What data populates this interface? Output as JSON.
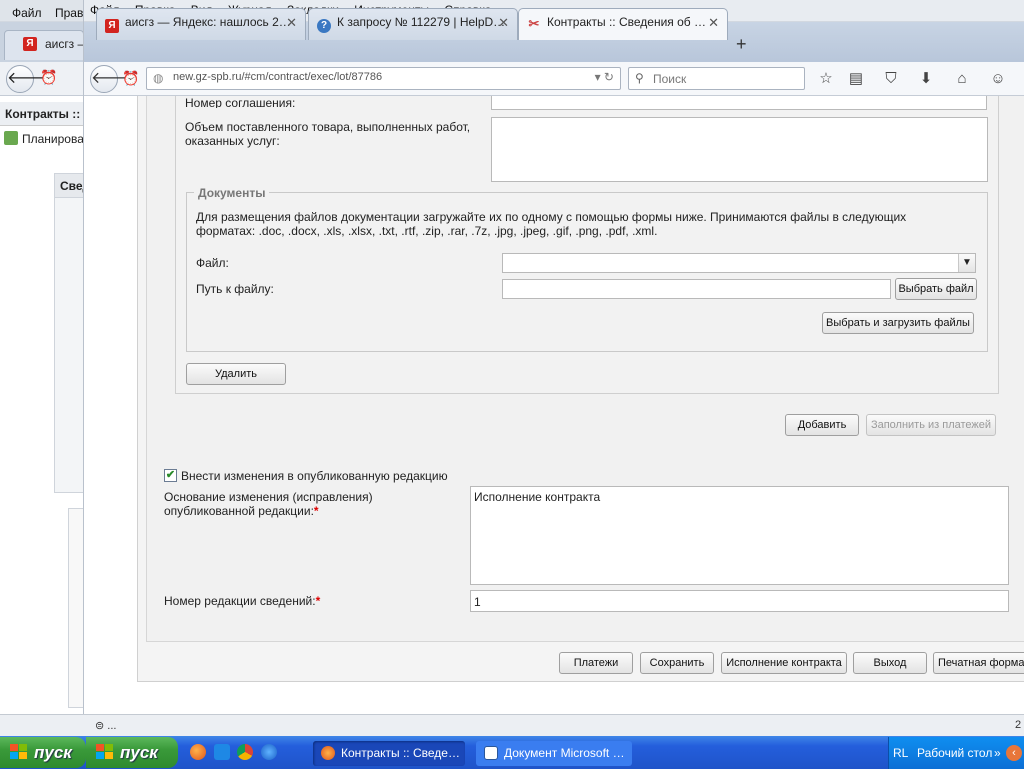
{
  "bg_window": {
    "menu": [
      "Файл",
      "Правка"
    ],
    "tab_title": "аисгз —",
    "page_header": "Контракты ::",
    "nav_item": "Планирован",
    "panel_title": "Свед",
    "status_text": "⊜ ..."
  },
  "menu": [
    "Файл",
    "Правка",
    "Вид",
    "Журнал",
    "Закладки",
    "Инструменты",
    "Справка"
  ],
  "tabs": [
    {
      "title": "аисгз — Яндекс: нашлось 2…",
      "icon": "Я",
      "color": "#d2241f"
    },
    {
      "title": "К запросу № 112279 | HelpD…",
      "icon": "?",
      "color": "#3a78c2"
    },
    {
      "title": "Контракты :: Сведения об …",
      "icon": "",
      "color": "#c44"
    }
  ],
  "url": "new.gz-spb.ru/#cm/contract/exec/lot/87786",
  "search_placeholder": "Поиск",
  "form": {
    "agreement_number_label": "Номер соглашения:",
    "volume_label": "Объем поставленного товара, выполненных работ, оказанных услуг:",
    "documents": {
      "legend": "Документы",
      "hint": "Для размещения файлов документации загружайте их по одному с помощью формы ниже. Принимаются файлы в следующих форматах: .doc, .docx, .xls, .xlsx, .txt, .rtf, .zip, .rar, .7z, .jpg, .jpeg, .gif, .png, .pdf, .xml.",
      "file_label": "Файл:",
      "path_label": "Путь к файлу:",
      "choose_file": "Выбрать файл",
      "choose_upload": "Выбрать и загрузить файлы"
    },
    "delete_button": "Удалить",
    "add_button": "Добавить",
    "fill_from_payments_button": "Заполнить из платежей",
    "publish_changes_label": "Внести изменения в опубликованную редакцию",
    "publish_changes_checked": true,
    "reason_label": "Основание изменения (исправления) опубликованной редакции:",
    "reason_value": "Исполнение контракта",
    "revision_label": "Номер редакции сведений:",
    "revision_value": "1"
  },
  "footer_buttons": {
    "payments": "Платежи",
    "save": "Сохранить",
    "contract_execution": "Исполнение контракта",
    "exit": "Выход",
    "print_form": "Печатная форма"
  },
  "status_text": "⊜ ...",
  "status_right": "2",
  "taskbar": {
    "start_label": "пуск",
    "items": [
      {
        "label": "Контракты :: Сведе…"
      },
      {
        "label": "Документ Microsoft …"
      }
    ],
    "tray_lang": "RL",
    "tray_desktop": "Рабочий стол"
  }
}
